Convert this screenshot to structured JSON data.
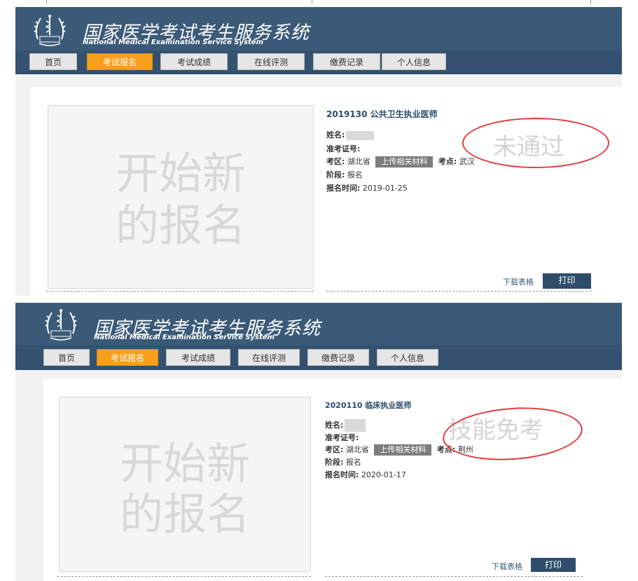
{
  "header": {
    "title_cn": "国家医学考试考生服务系统",
    "title_en": "National Medical Examination Service System"
  },
  "nav": {
    "items": [
      {
        "label": "首页"
      },
      {
        "label": "考试报名"
      },
      {
        "label": "考试成绩"
      },
      {
        "label": "在线评测"
      },
      {
        "label": "缴费记录"
      },
      {
        "label": "个人信息"
      }
    ],
    "active_index": 1
  },
  "new_registration": {
    "line1": "开始新",
    "line2": "的报名"
  },
  "labels": {
    "name": "姓名:",
    "ticket": "准考证号:",
    "region": "考区:",
    "site": "考点:",
    "stage": "阶段:",
    "reg_time": "报名时间:",
    "upload": "上传相关材料",
    "download": "下载表格",
    "print": "打印"
  },
  "records": [
    {
      "exam": "2019130 公共卫生执业医师",
      "region": "湖北省",
      "site": "武汉",
      "stage": "报名",
      "reg_time": "2019-01-25",
      "status": "未通过"
    },
    {
      "exam": "2020110 临床执业医师",
      "region": "湖北省",
      "site": "荆州",
      "stage": "报名",
      "reg_time": "2020-01-17",
      "status": "技能免考"
    }
  ],
  "colors": {
    "header": "#3b5a78",
    "nav_active": "#f7a01c",
    "annotation": "#e23a3a"
  }
}
